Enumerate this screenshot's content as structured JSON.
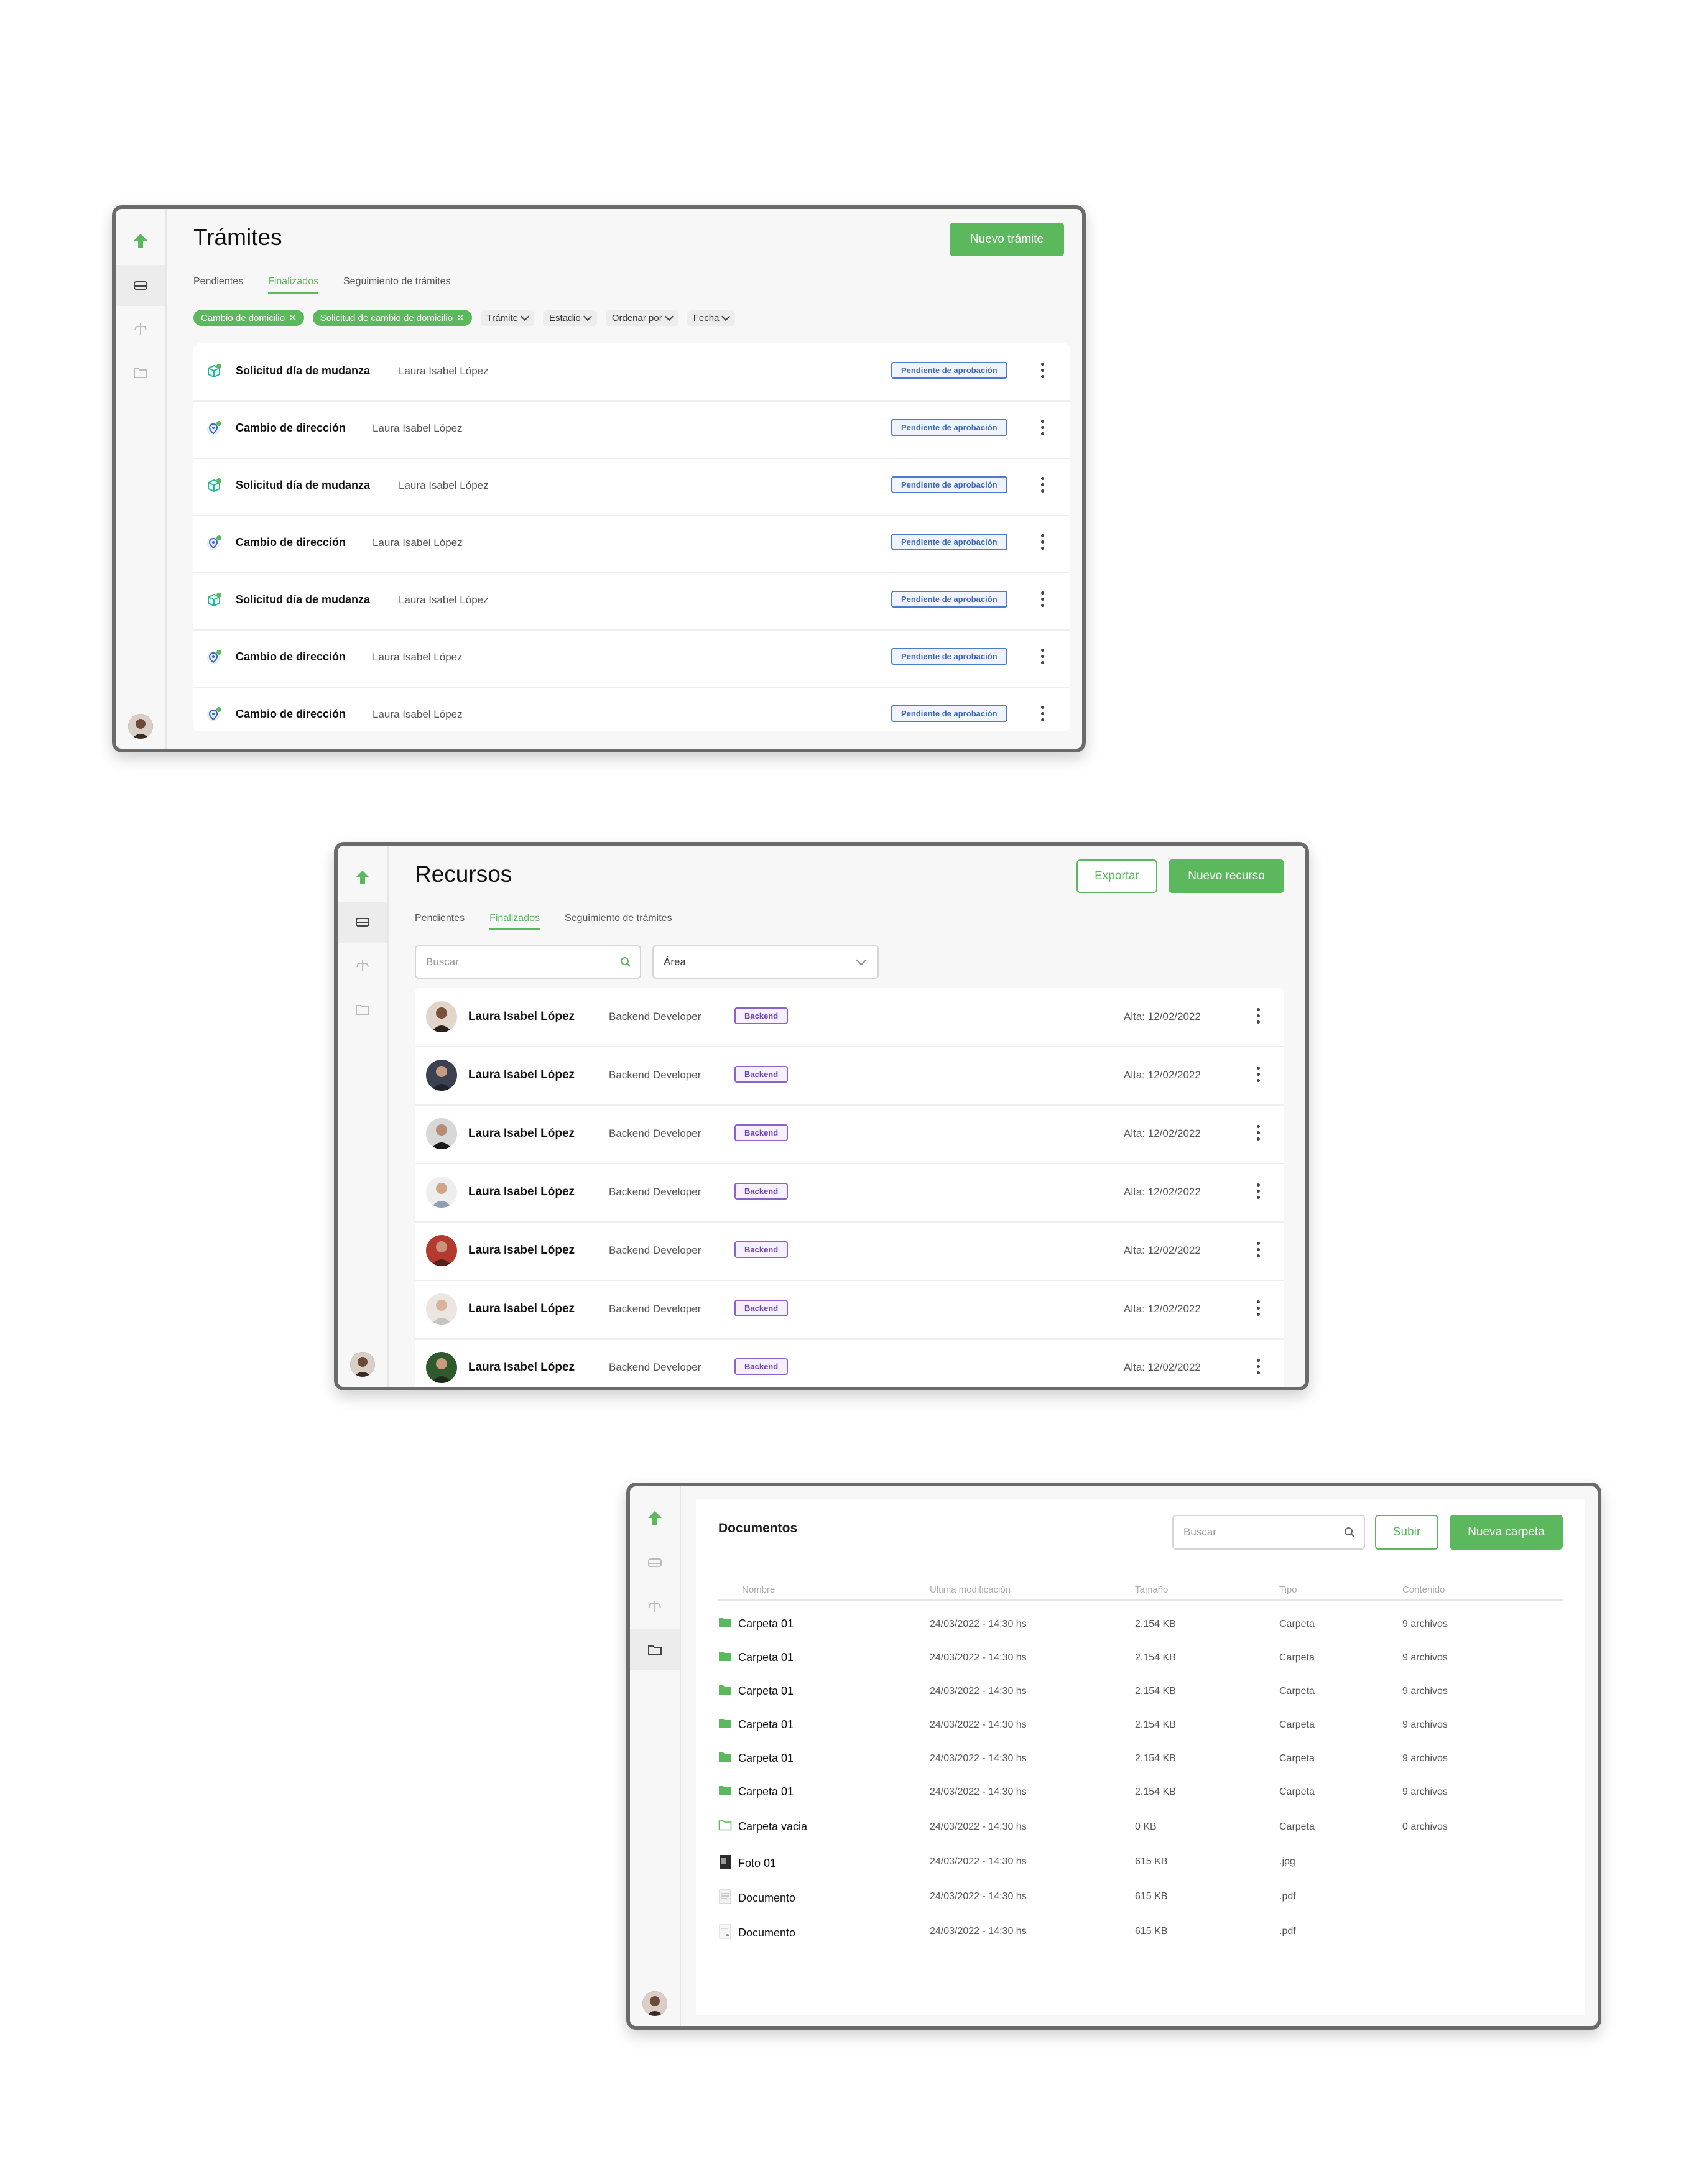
{
  "tramites": {
    "title": "Trámites",
    "new_button": "Nuevo trámite",
    "tabs": [
      "Pendientes",
      "Finalizados",
      "Seguimiento de trámites"
    ],
    "active_tab": 1,
    "chips": [
      "Cambio de domicilio",
      "Solicitud de cambio de domicilio"
    ],
    "filters": [
      "Trámite",
      "Estadío",
      "Ordenar por",
      "Fecha"
    ],
    "rows": [
      {
        "name": "Solicitud día de mudanza",
        "person": "Laura Isabel López",
        "status": "Pendiente de aprobación",
        "icon": "box-icon"
      },
      {
        "name": "Cambio de dirección",
        "person": "Laura Isabel López",
        "status": "Pendiente de aprobación",
        "icon": "location-pin-icon"
      },
      {
        "name": "Solicitud día de mudanza",
        "person": "Laura Isabel López",
        "status": "Pendiente de aprobación",
        "icon": "box-icon"
      },
      {
        "name": "Cambio de dirección",
        "person": "Laura Isabel López",
        "status": "Pendiente de aprobación",
        "icon": "location-pin-icon"
      },
      {
        "name": "Solicitud día de mudanza",
        "person": "Laura Isabel López",
        "status": "Pendiente de aprobación",
        "icon": "box-icon"
      },
      {
        "name": "Cambio de dirección",
        "person": "Laura Isabel López",
        "status": "Pendiente de aprobación",
        "icon": "location-pin-icon"
      },
      {
        "name": "Cambio de dirección",
        "person": "Laura Isabel López",
        "status": "Pendiente de aprobación",
        "icon": "location-pin-icon"
      }
    ]
  },
  "recursos": {
    "title": "Recursos",
    "export_button": "Exportar",
    "new_button": "Nuevo recurso",
    "tabs": [
      "Pendientes",
      "Finalizados",
      "Seguimiento de trámites"
    ],
    "active_tab": 1,
    "search_placeholder": "Buscar",
    "area_label": "Área",
    "rows": [
      {
        "name": "Laura Isabel López",
        "role": "Backend Developer",
        "tag": "Backend",
        "date": "Alta: 12/02/2022"
      },
      {
        "name": "Laura Isabel López",
        "role": "Backend Developer",
        "tag": "Backend",
        "date": "Alta: 12/02/2022"
      },
      {
        "name": "Laura Isabel López",
        "role": "Backend Developer",
        "tag": "Backend",
        "date": "Alta: 12/02/2022"
      },
      {
        "name": "Laura Isabel López",
        "role": "Backend Developer",
        "tag": "Backend",
        "date": "Alta: 12/02/2022"
      },
      {
        "name": "Laura Isabel López",
        "role": "Backend Developer",
        "tag": "Backend",
        "date": "Alta: 12/02/2022"
      },
      {
        "name": "Laura Isabel López",
        "role": "Backend Developer",
        "tag": "Backend",
        "date": "Alta: 12/02/2022"
      },
      {
        "name": "Laura Isabel López",
        "role": "Backend Developer",
        "tag": "Backend",
        "date": "Alta: 12/02/2022"
      }
    ]
  },
  "documentos": {
    "title": "Documentos",
    "search_placeholder": "Buscar",
    "upload_button": "Subir",
    "new_folder_button": "Nueva carpeta",
    "columns": [
      "Nombre",
      "Ultima modificación",
      "Tamaño",
      "Tipo",
      "Contenido"
    ],
    "rows": [
      {
        "name": "Carpeta 01",
        "modified": "24/03/2022 - 14:30 hs",
        "size": "2.154 KB",
        "type": "Carpeta",
        "content": "9 archivos",
        "icon": "folder-filled-icon"
      },
      {
        "name": "Carpeta 01",
        "modified": "24/03/2022 - 14:30 hs",
        "size": "2.154 KB",
        "type": "Carpeta",
        "content": "9 archivos",
        "icon": "folder-filled-icon"
      },
      {
        "name": "Carpeta 01",
        "modified": "24/03/2022 - 14:30 hs",
        "size": "2.154 KB",
        "type": "Carpeta",
        "content": "9 archivos",
        "icon": "folder-filled-icon"
      },
      {
        "name": "Carpeta 01",
        "modified": "24/03/2022 - 14:30 hs",
        "size": "2.154 KB",
        "type": "Carpeta",
        "content": "9 archivos",
        "icon": "folder-filled-icon"
      },
      {
        "name": "Carpeta 01",
        "modified": "24/03/2022 - 14:30 hs",
        "size": "2.154 KB",
        "type": "Carpeta",
        "content": "9 archivos",
        "icon": "folder-filled-icon"
      },
      {
        "name": "Carpeta 01",
        "modified": "24/03/2022 - 14:30 hs",
        "size": "2.154 KB",
        "type": "Carpeta",
        "content": "9 archivos",
        "icon": "folder-filled-icon"
      },
      {
        "name": "Carpeta vacia",
        "modified": "24/03/2022 - 14:30 hs",
        "size": "0 KB",
        "type": "Carpeta",
        "content": "0 archivos",
        "icon": "folder-outline-icon"
      },
      {
        "name": "Foto 01",
        "modified": "24/03/2022 - 14:30 hs",
        "size": "615 KB",
        "type": ".jpg",
        "content": "",
        "icon": "image-file-icon"
      },
      {
        "name": "Documento",
        "modified": "24/03/2022 - 14:30 hs",
        "size": "615 KB",
        "type": ".pdf",
        "content": "",
        "icon": "document-file-icon"
      },
      {
        "name": "Documento",
        "modified": "24/03/2022 - 14:30 hs",
        "size": "615 KB",
        "type": ".pdf",
        "content": "",
        "icon": "document-file-icon"
      }
    ]
  },
  "colors": {
    "accent": "#5cb85c",
    "status_blue": "#3b66b8",
    "tag_purple": "#6b3fb5"
  }
}
